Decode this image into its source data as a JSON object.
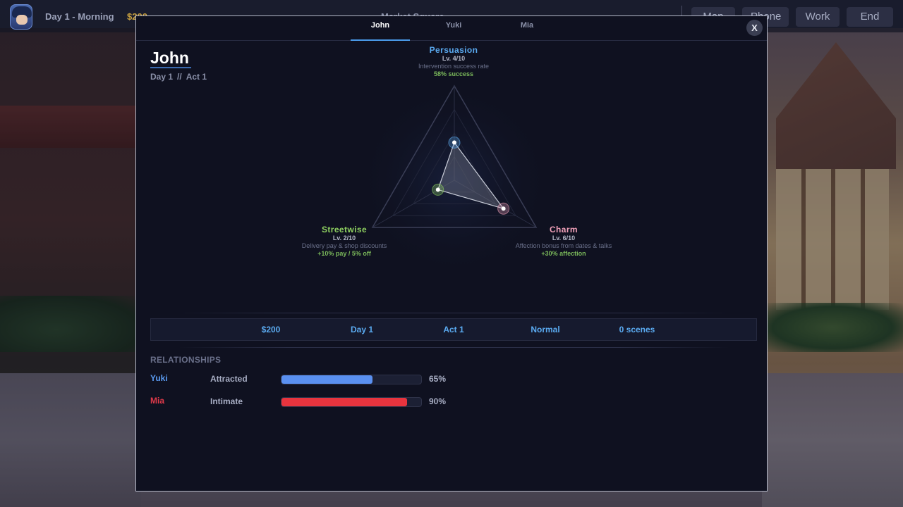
{
  "hud": {
    "day": "Day 1 - Morning",
    "money": "$200",
    "location": "Market Square",
    "buttons": [
      "Map",
      "Phone",
      "Work",
      "End"
    ]
  },
  "modal": {
    "tabs": [
      {
        "label": "John",
        "active": true
      },
      {
        "label": "Yuki",
        "active": false
      },
      {
        "label": "Mia",
        "active": false
      }
    ],
    "close_label": "X",
    "character": {
      "name": "John",
      "day": "Day 1",
      "sep": "//",
      "act": "Act 1"
    },
    "stats": {
      "max_level": 10,
      "persuasion": {
        "name": "Persuasion",
        "level": 4,
        "level_text": "Lv. 4/10",
        "desc": "Intervention success rate",
        "bonus": "58% success",
        "color": "#5aaaf0"
      },
      "charm": {
        "name": "Charm",
        "level": 6,
        "level_text": "Lv. 6/10",
        "desc": "Affection bonus from dates & talks",
        "bonus": "+30% affection",
        "color": "#f0a0b8"
      },
      "streetwise": {
        "name": "Streetwise",
        "level": 2,
        "level_text": "Lv. 2/10",
        "desc": "Delivery pay & shop discounts",
        "bonus": "+10% pay / 5% off",
        "color": "#8ed060"
      }
    },
    "summary": {
      "money": "$200",
      "day": "Day 1",
      "act": "Act 1",
      "difficulty": "Normal",
      "scenes": "0 scenes"
    },
    "relationships": {
      "title": "RELATIONSHIPS",
      "items": [
        {
          "name": "Yuki",
          "status": "Attracted",
          "percent": 65,
          "percent_text": "65%",
          "name_color": "#5a9af0",
          "bar_color": "#5a90f0"
        },
        {
          "name": "Mia",
          "status": "Intimate",
          "percent": 90,
          "percent_text": "90%",
          "name_color": "#e03a4a",
          "bar_color": "#e8343e"
        }
      ]
    }
  }
}
